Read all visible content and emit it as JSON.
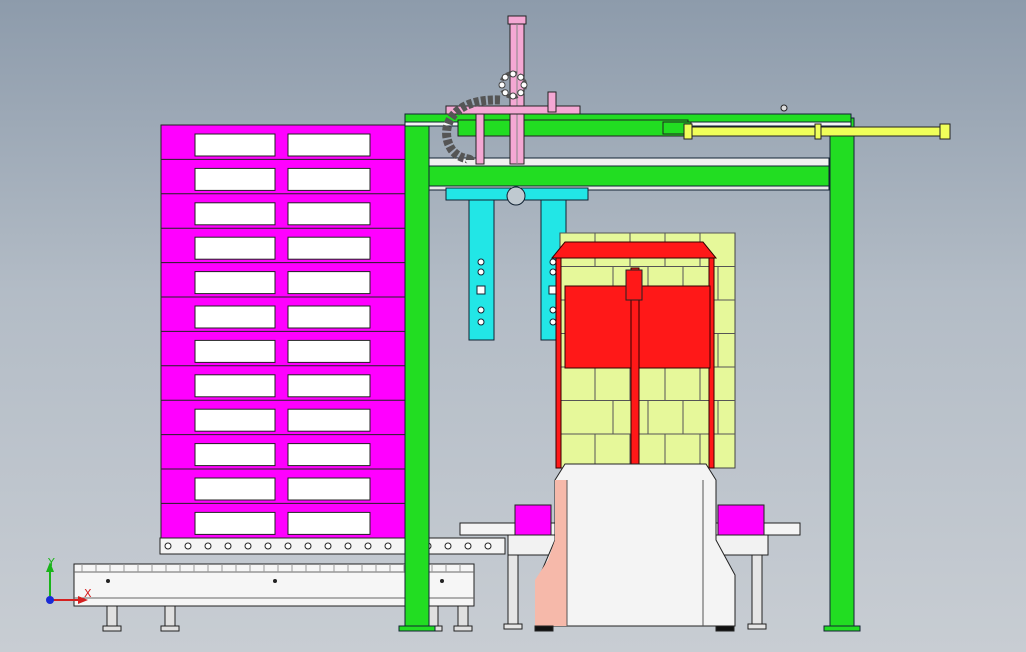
{
  "triad": {
    "x_label": "X",
    "y_label": "Y"
  },
  "colors": {
    "pallet": "#ff00ff",
    "frame": "#22dd22",
    "gripper": "#22e6e6",
    "cylinder": "#f5a8d4",
    "cartons": "#e6f89a",
    "wrap": "#ff1818",
    "conveyor": "#f2f2f2",
    "rail": "#f0ff5a"
  }
}
